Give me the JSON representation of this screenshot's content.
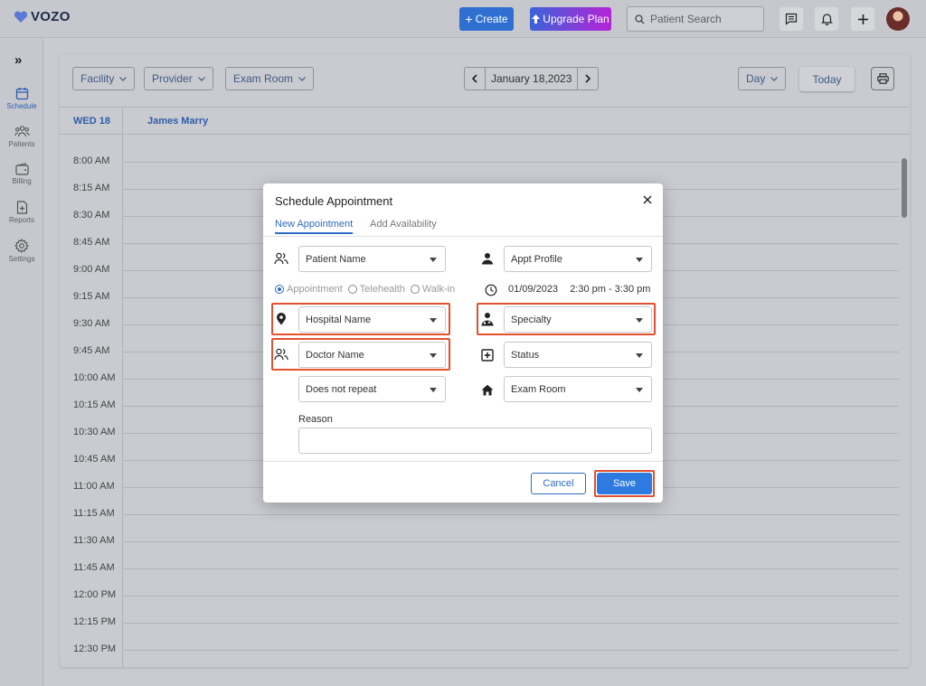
{
  "app": {
    "brand": "VOZO",
    "brand_color": "#2f6fd2"
  },
  "topbar": {
    "create_label": "Create",
    "upgrade_label": "Upgrade Plan",
    "search_placeholder": "Patient Search",
    "icons": [
      "chat-icon",
      "bell-icon",
      "plus-icon",
      "user-avatar"
    ]
  },
  "sidebar": {
    "expand_glyph": "»",
    "items": [
      {
        "label": "Schedule",
        "icon": "calendar-icon",
        "active": true
      },
      {
        "label": "Patients",
        "icon": "patients-icon",
        "active": false
      },
      {
        "label": "Billing",
        "icon": "wallet-icon",
        "active": false
      },
      {
        "label": "Reports",
        "icon": "report-icon",
        "active": false
      },
      {
        "label": "Settings",
        "icon": "gear-icon",
        "active": false
      }
    ]
  },
  "calendar": {
    "filters": {
      "facility": "Facility",
      "provider": "Provider",
      "exam_room": "Exam Room"
    },
    "date_label": "January 18,2023",
    "view": "Day",
    "today_label": "Today",
    "day_header": "WED 18",
    "provider_header": "James Marry",
    "times": [
      "8:00 AM",
      "8:15 AM",
      "8:30 AM",
      "8:45 AM",
      "9:00 AM",
      "9:15 AM",
      "9:30 AM",
      "9:45 AM",
      "10:00 AM",
      "10:15 AM",
      "10:30 AM",
      "10:45 AM",
      "11:00 AM",
      "11:15 AM",
      "11:30 AM",
      "11:45 AM",
      "12:00 PM",
      "12:15 PM",
      "12:30 PM"
    ]
  },
  "modal": {
    "title": "Schedule Appointment",
    "tabs": {
      "active": "New Appointment",
      "inactive": "Add Availability"
    },
    "fields": {
      "patient_name": "Patient Name",
      "appt_profile": "Appt Profile",
      "hospital_name": "Hospital Name",
      "specialty": "Specialty",
      "doctor_name": "Doctor Name",
      "status": "Status",
      "repeat": "Does not repeat",
      "exam_room": "Exam Room"
    },
    "visit_types": {
      "appointment": "Appointment",
      "telehealth": "Telehealth",
      "walkin": "Walk-in",
      "selected": "Appointment"
    },
    "appt_date": "01/09/2023",
    "appt_time": "2:30 pm - 3:30 pm",
    "reason_label": "Reason",
    "reason_value": "",
    "cancel_label": "Cancel",
    "save_label": "Save"
  }
}
